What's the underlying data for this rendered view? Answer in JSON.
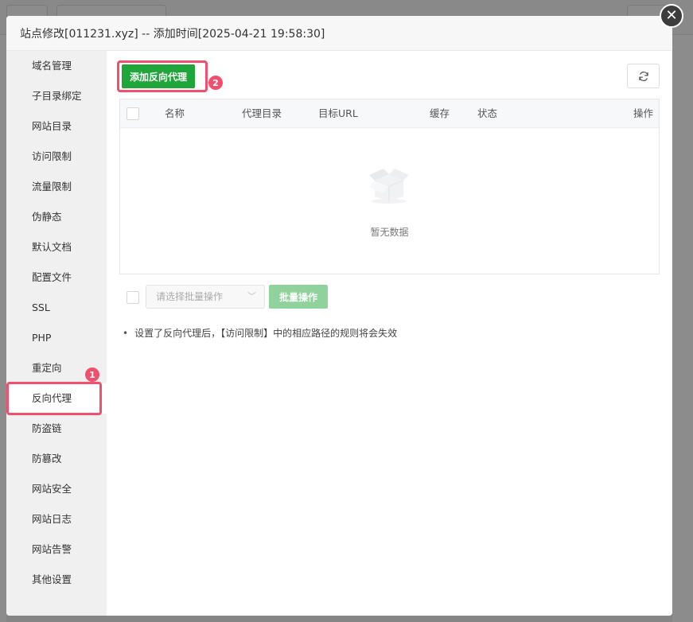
{
  "dialog": {
    "title": "站点修改[011231.xyz] -- 添加时间[2025-04-21 19:58:30]"
  },
  "nav": {
    "items": [
      {
        "label": "域名管理"
      },
      {
        "label": "子目录绑定"
      },
      {
        "label": "网站目录"
      },
      {
        "label": "访问限制"
      },
      {
        "label": "流量限制"
      },
      {
        "label": "伪静态"
      },
      {
        "label": "默认文档"
      },
      {
        "label": "配置文件"
      },
      {
        "label": "SSL"
      },
      {
        "label": "PHP"
      },
      {
        "label": "重定向"
      },
      {
        "label": "反向代理"
      },
      {
        "label": "防盗链"
      },
      {
        "label": "防篡改"
      },
      {
        "label": "网站安全"
      },
      {
        "label": "网站日志"
      },
      {
        "label": "网站告警"
      },
      {
        "label": "其他设置"
      }
    ],
    "active": "反向代理"
  },
  "toolbar": {
    "add_label": "添加反向代理"
  },
  "table": {
    "columns": [
      "名称",
      "代理目录",
      "目标URL",
      "缓存",
      "状态",
      "操作"
    ],
    "empty_text": "暂无数据"
  },
  "batch": {
    "placeholder": "请选择批量操作",
    "button": "批量操作"
  },
  "tips": [
    "设置了反向代理后，【访问限制】中的相应路径的规则将会失效"
  ],
  "annotations": {
    "step1": "1",
    "step2": "2"
  },
  "colors": {
    "primary": "#20a53a",
    "annotation": "#f0506e"
  }
}
